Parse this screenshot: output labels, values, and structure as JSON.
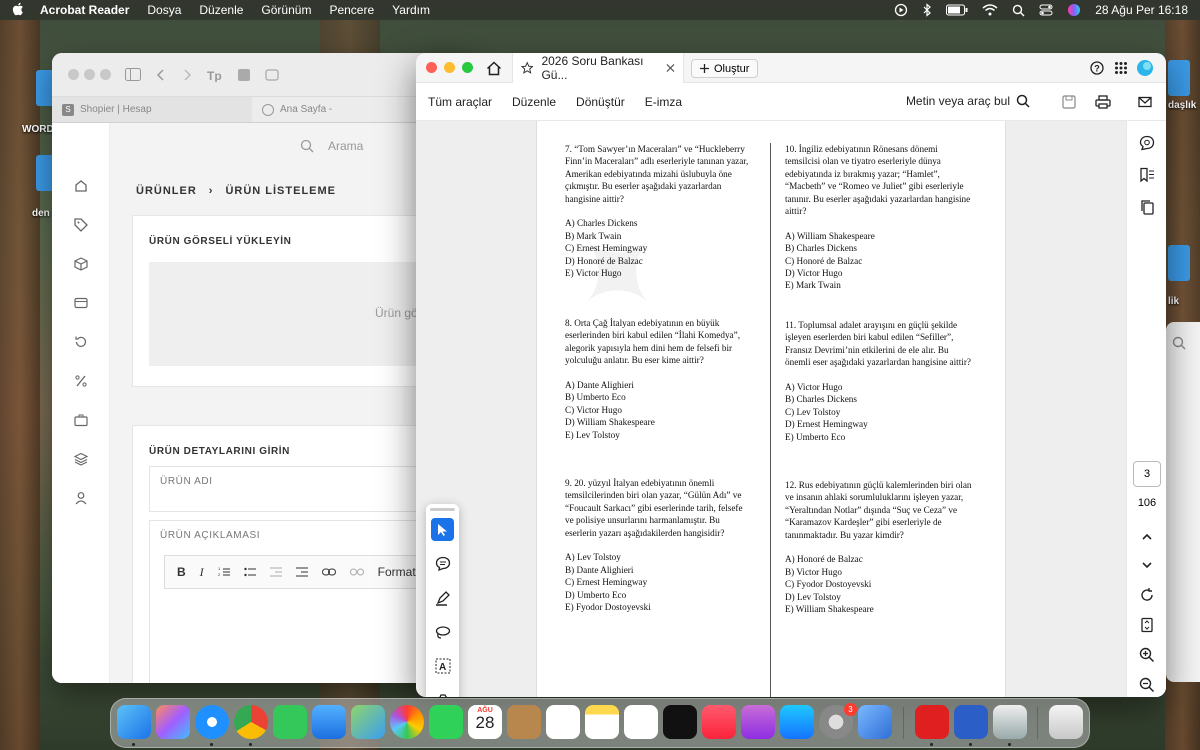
{
  "menubar": {
    "app_name": "Acrobat Reader",
    "menus": [
      "Dosya",
      "Düzenle",
      "Görünüm",
      "Pencere",
      "Yardım"
    ],
    "clock": "28 Ağu Per  16:18"
  },
  "desktop": {
    "labels": [
      "WORD",
      "den",
      "daşlık",
      "lik"
    ]
  },
  "back_window": {
    "tabs": [
      "Shopier | Hesap",
      "Ana Sayfa - "
    ],
    "search_label": "Arama",
    "breadcrumb_root": "ÜRÜNLER",
    "breadcrumb_sep": "›",
    "breadcrumb_current": "ÜRÜN LİSTELEME",
    "upload_title": "ÜRÜN GÖRSELİ YÜKLEYİN",
    "upload_placeholder": "Ürün gö",
    "details_title": "ÜRÜN DETAYLARINI GİRİN",
    "name_label": "ÜRÜN ADI",
    "desc_label": "ÜRÜN AÇIKLAMASI",
    "editor_format": "Format",
    "editor_bold": "B",
    "editor_italic": "I"
  },
  "acrobat": {
    "tab_title": "2026 Soru Bankası Gü...",
    "new_button": "Oluştur",
    "menu": [
      "Tüm araçlar",
      "Düzenle",
      "Dönüştür",
      "E-imza"
    ],
    "find_label": "Metin veya araç bul",
    "current_page": "3",
    "total_pages": "106",
    "left_questions": [
      "7. “Tom Sawyer’ın Maceraları” ve “Huckleberry\nFinn’in Maceraları” adlı eserleriyle tanınan yazar,\nAmerikan edebiyatında mizahi üslubuyla öne\nçıkmıştır. Bu eserler aşağıdaki yazarlardan\nhangisine aittir?\n\nA) Charles Dickens\nB) Mark Twain\nC) Ernest Hemingway\nD) Honoré de Balzac\nE) Victor Hugo",
      "8. Orta Çağ İtalyan edebiyatının en büyük\neserlerinden biri kabul edilen “İlahi Komedya”,\nalegorik yapısıyla hem dini hem de felsefi bir\nyolculuğu anlatır. Bu eser kime aittir?\n\nA) Dante Alighieri\nB) Umberto Eco\nC) Victor Hugo\nD) William Shakespeare\nE) Lev Tolstoy",
      "9. 20. yüzyıl İtalyan edebiyatının önemli\ntemsilcilerinden biri olan yazar, “Gülün Adı” ve\n“Foucault Sarkacı” gibi eserlerinde tarih, felsefe\nve polisiye unsurlarını harmanlamıştır. Bu\neserlerin yazarı aşağıdakilerden hangisidir?\n\nA) Lev Tolstoy\nB) Dante Alighieri\nC) Ernest Hemingway\nD) Umberto Eco\nE) Fyodor Dostoyevski"
    ],
    "right_questions": [
      "10. İngiliz edebiyatının Rönesans dönemi\ntemsilcisi olan ve tiyatro eserleriyle dünya\nedebiyatında iz bırakmış yazar; “Hamlet”,\n“Macbeth” ve “Romeo ve Juliet” gibi eserleriyle\ntanınır. Bu eserler aşağıdaki yazarlardan hangisine\naittir?\n\nA) William Shakespeare\nB) Charles Dickens\nC) Honoré de Balzac\nD) Victor Hugo\nE) Mark Twain",
      "11. Toplumsal adalet arayışını en güçlü şekilde\nişleyen eserlerden biri kabul edilen “Sefiller”,\nFransız Devrimi’nin etkilerini de ele alır. Bu\nönemli eser aşağıdaki yazarlardan hangisine aittir?\n\nA) Victor Hugo\nB) Charles Dickens\nC) Lev Tolstoy\nD) Ernest Hemingway\nE) Umberto Eco",
      "12. Rus edebiyatının güçlü kalemlerinden biri olan\nve insanın ahlaki sorumluluklarını işleyen yazar,\n“Yeraltından Notlar” dışında “Suç ve Ceza” ve\n“Karamazov Kardeşler” gibi eserleriyle de\ntanınmaktadır. Bu yazar kimdir?\n\nA) Honoré de Balzac\nB) Victor Hugo\nC) Fyodor Dostoyevski\nD) Lev Tolstoy\nE) William Shakespeare"
    ]
  },
  "dock": {
    "calendar_month": "AĞU",
    "calendar_day": "28",
    "settings_badge": "3"
  }
}
